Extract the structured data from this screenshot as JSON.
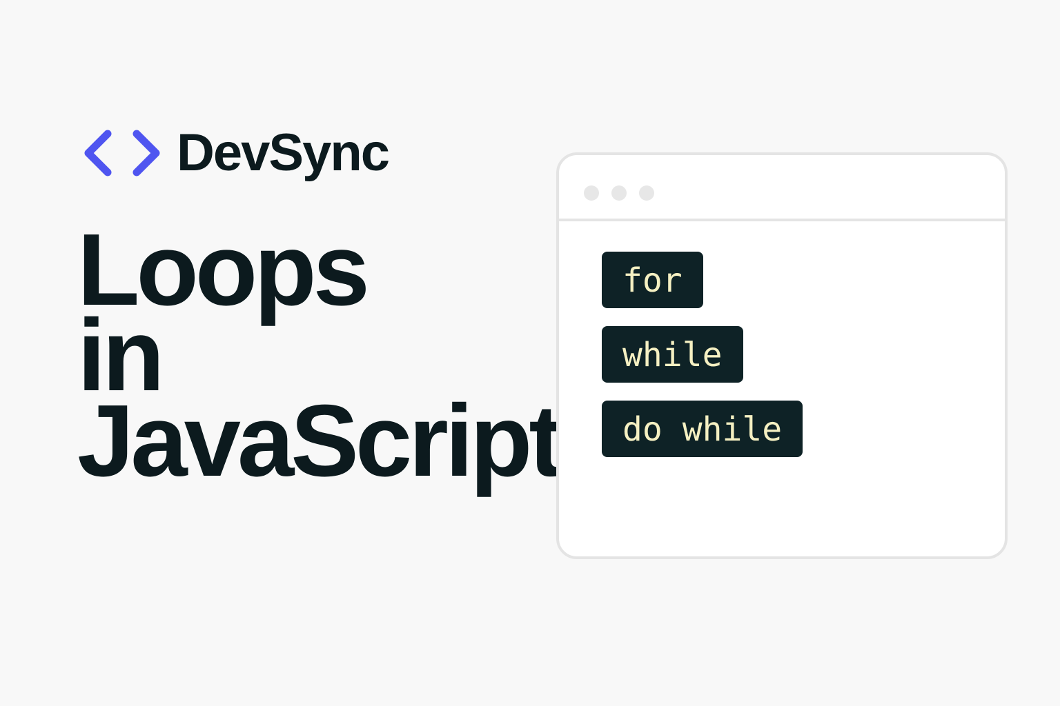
{
  "brand": {
    "name": "DevSync",
    "accent_color": "#4f55f0",
    "icon": "chevrons-code-icon"
  },
  "headline": {
    "lines": [
      "Loops",
      "in",
      "JavaScript"
    ]
  },
  "code_window": {
    "keywords": [
      "for",
      "while",
      "do while"
    ],
    "keyword_bg": "#0e2226",
    "keyword_color": "#f5f0c2"
  }
}
